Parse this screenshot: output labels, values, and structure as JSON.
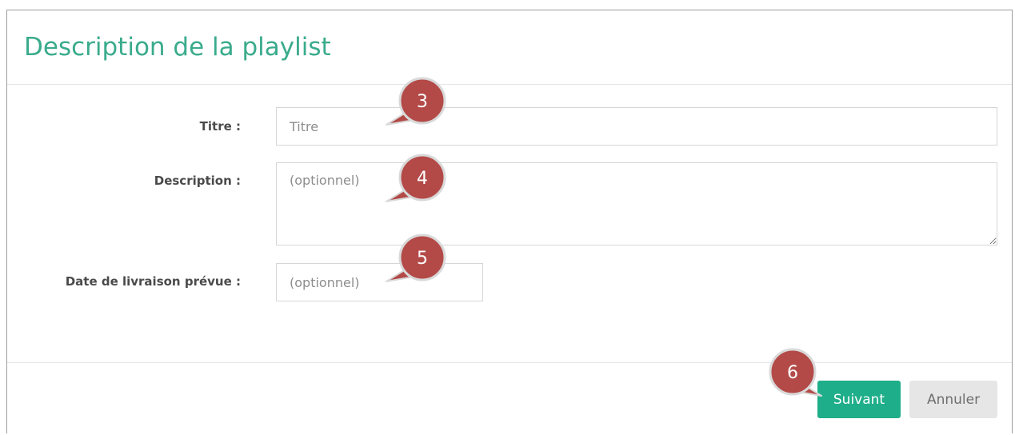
{
  "modal": {
    "title": "Description de la playlist"
  },
  "form": {
    "title_label": "Titre :",
    "title_placeholder": "Titre",
    "description_label": "Description :",
    "description_placeholder": "(optionnel)",
    "date_label": "Date de livraison prévue :",
    "date_placeholder": "(optionnel)"
  },
  "footer": {
    "next_label": "Suivant",
    "cancel_label": "Annuler"
  },
  "callouts": {
    "title_step": "3",
    "description_step": "4",
    "date_step": "5",
    "next_step": "6"
  },
  "colors": {
    "accent": "#3aab8c",
    "primary_button": "#1fae8a",
    "callout_fill": "#b34a48",
    "callout_border": "#d9d9d9"
  }
}
